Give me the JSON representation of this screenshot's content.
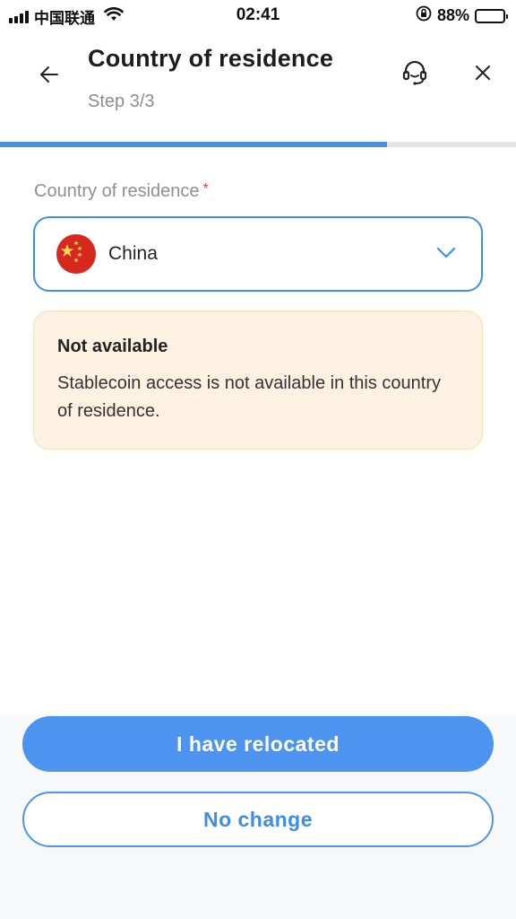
{
  "status_bar": {
    "carrier": "中国联通",
    "time": "02:41",
    "battery": "88%",
    "battery_level": 0.88
  },
  "header": {
    "title": "Country of residence",
    "step": "Step 3/3",
    "progress": 0.75,
    "icons": {
      "back": "arrow-left-icon",
      "support": "headset-icon",
      "close": "close-icon"
    }
  },
  "form": {
    "label": "Country of residence",
    "required_mark": "*",
    "selected_country": "China",
    "flag": "china-flag-icon"
  },
  "notice": {
    "title": "Not available",
    "message": "Stablecoin access is not available in this country of residence."
  },
  "actions": {
    "primary": "I have relocated",
    "secondary": "No change"
  },
  "colors": {
    "accent": "#4d94f0",
    "notice_bg": "#fdf1e1",
    "notice_border": "#f5dfb8",
    "required": "#e0443c"
  }
}
